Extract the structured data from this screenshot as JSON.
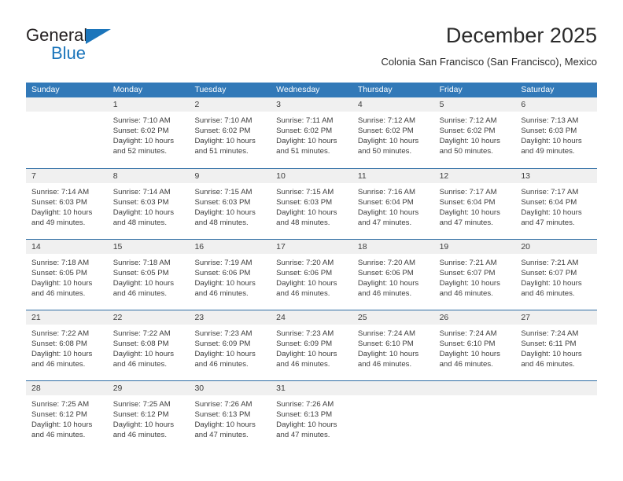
{
  "logo": {
    "word_one": "General",
    "word_two": "Blue",
    "triangle_icon": "triangle-icon",
    "accent_color": "#1b75bb"
  },
  "header": {
    "title": "December 2025",
    "subtitle": "Colonia San Francisco (San Francisco), Mexico"
  },
  "theme": {
    "header_blue": "#3279b8",
    "row_divider": "#2e6da4",
    "day_band": "#f0f0f0",
    "text": "#3d3d3d"
  },
  "calendar": {
    "weekdays": [
      "Sunday",
      "Monday",
      "Tuesday",
      "Wednesday",
      "Thursday",
      "Friday",
      "Saturday"
    ],
    "weeks": [
      [
        {
          "day": "",
          "lines": []
        },
        {
          "day": "1",
          "lines": [
            "Sunrise: 7:10 AM",
            "Sunset: 6:02 PM",
            "Daylight: 10 hours",
            "and 52 minutes."
          ]
        },
        {
          "day": "2",
          "lines": [
            "Sunrise: 7:10 AM",
            "Sunset: 6:02 PM",
            "Daylight: 10 hours",
            "and 51 minutes."
          ]
        },
        {
          "day": "3",
          "lines": [
            "Sunrise: 7:11 AM",
            "Sunset: 6:02 PM",
            "Daylight: 10 hours",
            "and 51 minutes."
          ]
        },
        {
          "day": "4",
          "lines": [
            "Sunrise: 7:12 AM",
            "Sunset: 6:02 PM",
            "Daylight: 10 hours",
            "and 50 minutes."
          ]
        },
        {
          "day": "5",
          "lines": [
            "Sunrise: 7:12 AM",
            "Sunset: 6:02 PM",
            "Daylight: 10 hours",
            "and 50 minutes."
          ]
        },
        {
          "day": "6",
          "lines": [
            "Sunrise: 7:13 AM",
            "Sunset: 6:03 PM",
            "Daylight: 10 hours",
            "and 49 minutes."
          ]
        }
      ],
      [
        {
          "day": "7",
          "lines": [
            "Sunrise: 7:14 AM",
            "Sunset: 6:03 PM",
            "Daylight: 10 hours",
            "and 49 minutes."
          ]
        },
        {
          "day": "8",
          "lines": [
            "Sunrise: 7:14 AM",
            "Sunset: 6:03 PM",
            "Daylight: 10 hours",
            "and 48 minutes."
          ]
        },
        {
          "day": "9",
          "lines": [
            "Sunrise: 7:15 AM",
            "Sunset: 6:03 PM",
            "Daylight: 10 hours",
            "and 48 minutes."
          ]
        },
        {
          "day": "10",
          "lines": [
            "Sunrise: 7:15 AM",
            "Sunset: 6:03 PM",
            "Daylight: 10 hours",
            "and 48 minutes."
          ]
        },
        {
          "day": "11",
          "lines": [
            "Sunrise: 7:16 AM",
            "Sunset: 6:04 PM",
            "Daylight: 10 hours",
            "and 47 minutes."
          ]
        },
        {
          "day": "12",
          "lines": [
            "Sunrise: 7:17 AM",
            "Sunset: 6:04 PM",
            "Daylight: 10 hours",
            "and 47 minutes."
          ]
        },
        {
          "day": "13",
          "lines": [
            "Sunrise: 7:17 AM",
            "Sunset: 6:04 PM",
            "Daylight: 10 hours",
            "and 47 minutes."
          ]
        }
      ],
      [
        {
          "day": "14",
          "lines": [
            "Sunrise: 7:18 AM",
            "Sunset: 6:05 PM",
            "Daylight: 10 hours",
            "and 46 minutes."
          ]
        },
        {
          "day": "15",
          "lines": [
            "Sunrise: 7:18 AM",
            "Sunset: 6:05 PM",
            "Daylight: 10 hours",
            "and 46 minutes."
          ]
        },
        {
          "day": "16",
          "lines": [
            "Sunrise: 7:19 AM",
            "Sunset: 6:06 PM",
            "Daylight: 10 hours",
            "and 46 minutes."
          ]
        },
        {
          "day": "17",
          "lines": [
            "Sunrise: 7:20 AM",
            "Sunset: 6:06 PM",
            "Daylight: 10 hours",
            "and 46 minutes."
          ]
        },
        {
          "day": "18",
          "lines": [
            "Sunrise: 7:20 AM",
            "Sunset: 6:06 PM",
            "Daylight: 10 hours",
            "and 46 minutes."
          ]
        },
        {
          "day": "19",
          "lines": [
            "Sunrise: 7:21 AM",
            "Sunset: 6:07 PM",
            "Daylight: 10 hours",
            "and 46 minutes."
          ]
        },
        {
          "day": "20",
          "lines": [
            "Sunrise: 7:21 AM",
            "Sunset: 6:07 PM",
            "Daylight: 10 hours",
            "and 46 minutes."
          ]
        }
      ],
      [
        {
          "day": "21",
          "lines": [
            "Sunrise: 7:22 AM",
            "Sunset: 6:08 PM",
            "Daylight: 10 hours",
            "and 46 minutes."
          ]
        },
        {
          "day": "22",
          "lines": [
            "Sunrise: 7:22 AM",
            "Sunset: 6:08 PM",
            "Daylight: 10 hours",
            "and 46 minutes."
          ]
        },
        {
          "day": "23",
          "lines": [
            "Sunrise: 7:23 AM",
            "Sunset: 6:09 PM",
            "Daylight: 10 hours",
            "and 46 minutes."
          ]
        },
        {
          "day": "24",
          "lines": [
            "Sunrise: 7:23 AM",
            "Sunset: 6:09 PM",
            "Daylight: 10 hours",
            "and 46 minutes."
          ]
        },
        {
          "day": "25",
          "lines": [
            "Sunrise: 7:24 AM",
            "Sunset: 6:10 PM",
            "Daylight: 10 hours",
            "and 46 minutes."
          ]
        },
        {
          "day": "26",
          "lines": [
            "Sunrise: 7:24 AM",
            "Sunset: 6:10 PM",
            "Daylight: 10 hours",
            "and 46 minutes."
          ]
        },
        {
          "day": "27",
          "lines": [
            "Sunrise: 7:24 AM",
            "Sunset: 6:11 PM",
            "Daylight: 10 hours",
            "and 46 minutes."
          ]
        }
      ],
      [
        {
          "day": "28",
          "lines": [
            "Sunrise: 7:25 AM",
            "Sunset: 6:12 PM",
            "Daylight: 10 hours",
            "and 46 minutes."
          ]
        },
        {
          "day": "29",
          "lines": [
            "Sunrise: 7:25 AM",
            "Sunset: 6:12 PM",
            "Daylight: 10 hours",
            "and 46 minutes."
          ]
        },
        {
          "day": "30",
          "lines": [
            "Sunrise: 7:26 AM",
            "Sunset: 6:13 PM",
            "Daylight: 10 hours",
            "and 47 minutes."
          ]
        },
        {
          "day": "31",
          "lines": [
            "Sunrise: 7:26 AM",
            "Sunset: 6:13 PM",
            "Daylight: 10 hours",
            "and 47 minutes."
          ]
        },
        {
          "day": "",
          "lines": []
        },
        {
          "day": "",
          "lines": []
        },
        {
          "day": "",
          "lines": []
        }
      ]
    ]
  }
}
